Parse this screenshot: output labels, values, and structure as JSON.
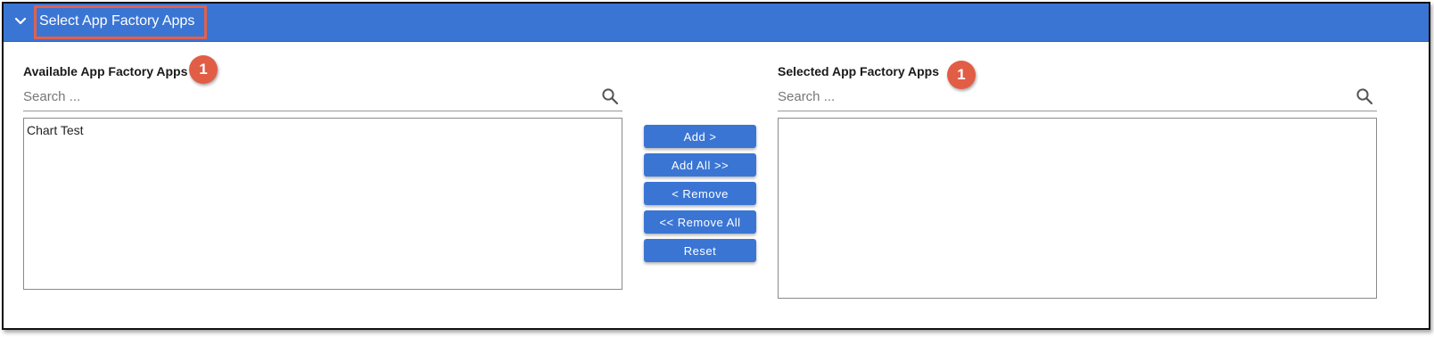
{
  "panel": {
    "title": "Select App Factory Apps",
    "expand_icon": "chevron-down-icon"
  },
  "available": {
    "label": "Available App Factory Apps",
    "badge": "1",
    "search_placeholder": "Search ...",
    "items": [
      "Chart Test"
    ]
  },
  "selected": {
    "label": "Selected App Factory Apps",
    "badge": "1",
    "search_placeholder": "Search ...",
    "items": []
  },
  "actions": {
    "add": "Add >",
    "add_all": "Add All >>",
    "remove": "< Remove",
    "remove_all": "<< Remove All",
    "reset": "Reset"
  },
  "colors": {
    "header_bg": "#3a75d4",
    "button_bg": "#3a75d4",
    "highlight_border": "#e0614d",
    "badge_bg": "#e25d45"
  }
}
